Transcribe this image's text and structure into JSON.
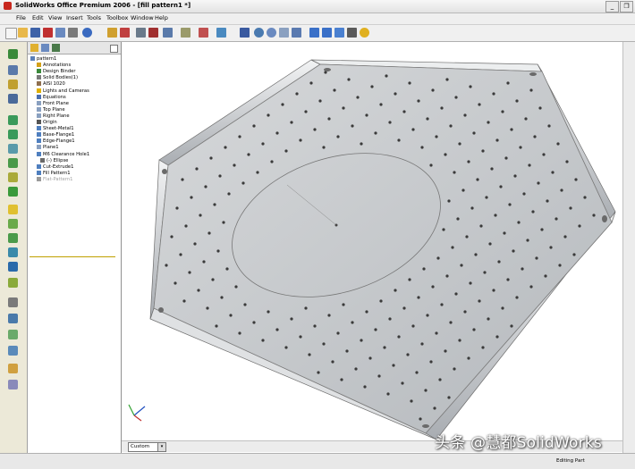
{
  "window": {
    "title": "SolidWorks Office Premium 2006 - [fill pattern1 *]",
    "minimize": "_",
    "restore": "❐"
  },
  "menu": [
    "File",
    "Edit",
    "View",
    "Insert",
    "Tools",
    "Toolbox",
    "Window",
    "Help"
  ],
  "tree": [
    {
      "label": "pattern1",
      "icon": "part-icon",
      "color": "#5a7fb8"
    },
    {
      "label": "Annotations",
      "icon": "annotations-icon",
      "color": "#d4a017"
    },
    {
      "label": "Design Binder",
      "icon": "design-binder-icon",
      "color": "#3a8a3a"
    },
    {
      "label": "Solid Bodies(1)",
      "icon": "solid-bodies-icon",
      "color": "#7a7a7a"
    },
    {
      "label": "AISI 1020",
      "icon": "material-icon",
      "color": "#8f6f4f"
    },
    {
      "label": "Lights and Cameras",
      "icon": "lights-icon",
      "color": "#e0b000"
    },
    {
      "label": "Equations",
      "icon": "equations-icon",
      "color": "#4a6fb0"
    },
    {
      "label": "Front Plane",
      "icon": "plane-icon",
      "color": "#8aa0c0"
    },
    {
      "label": "Top Plane",
      "icon": "plane-icon",
      "color": "#8aa0c0"
    },
    {
      "label": "Right Plane",
      "icon": "plane-icon",
      "color": "#8aa0c0"
    },
    {
      "label": "Origin",
      "icon": "origin-icon",
      "color": "#555555"
    },
    {
      "label": "Sheet-Metal1",
      "icon": "sheet-metal-icon",
      "color": "#4f7fbf"
    },
    {
      "label": "Base-Flange1",
      "icon": "base-flange-icon",
      "color": "#4f7fbf"
    },
    {
      "label": "Edge-Flange1",
      "icon": "edge-flange-icon",
      "color": "#4f7fbf"
    },
    {
      "label": "Plane1",
      "icon": "plane-icon",
      "color": "#8aa0c0"
    },
    {
      "label": "M6 Clearance Hole1",
      "icon": "hole-wizard-icon",
      "color": "#4f7fbf"
    },
    {
      "label": "(-) Ellipse",
      "icon": "sketch-icon",
      "color": "#6a6a6a"
    },
    {
      "label": "Cut-Extrude1",
      "icon": "cut-extrude-icon",
      "color": "#4f7fbf"
    },
    {
      "label": "Fill Pattern1",
      "icon": "fill-pattern-icon",
      "color": "#4f7fbf"
    },
    {
      "label": "Flat-Pattern1",
      "icon": "flat-pattern-icon",
      "color": "#9a9a9a",
      "greyed": true
    }
  ],
  "bottom": {
    "view_tab": "Custom"
  },
  "status": {
    "mode": "Editing Part"
  },
  "watermark": "头条 @慧都SolidWorks"
}
